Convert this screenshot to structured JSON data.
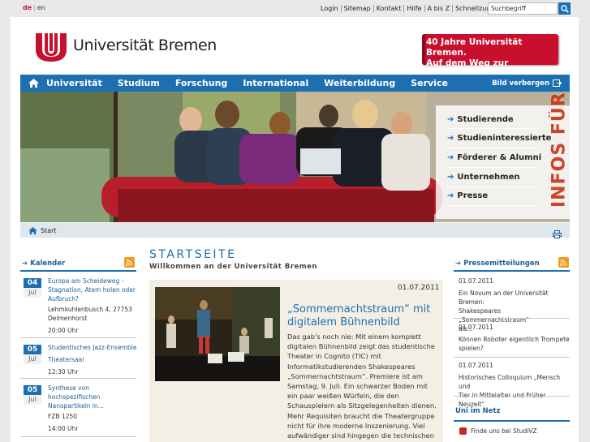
{
  "lang": {
    "de": "de",
    "en": "en"
  },
  "utility": [
    "Login",
    "Sitemap",
    "Kontakt",
    "Hilfe",
    "A bis Z",
    "Schnellzugriff"
  ],
  "search": {
    "placeholder": "Suchbegriff"
  },
  "header": {
    "logo_text": "Universität Bremen",
    "banner_line1": "40 Jahre Universität Bremen.",
    "banner_line2": "Auf dem Weg zur Exzellenz!"
  },
  "nav": {
    "items": [
      "Universität",
      "Studium",
      "Forschung",
      "International",
      "Weiterbildung",
      "Service"
    ],
    "hide_image": "Bild verbergen"
  },
  "hero_menu": {
    "items": [
      "Studierende",
      "Studieninteressierte",
      "Förderer & Alumni",
      "Unternehmen",
      "Presse"
    ],
    "side_text": "INFOS FÜR"
  },
  "breadcrumb": {
    "home": "Start"
  },
  "calendar": {
    "title": "Kalender",
    "events": [
      {
        "day": "04",
        "month": "Jul",
        "title": "Europa am Scheideweg - Stagnation, Atem holen oder Aufbruch?",
        "place": "Lehmkuhlenbusch 4, 27753 Delmenhorst",
        "time": "20:00 Uhr"
      },
      {
        "day": "05",
        "month": "Jul",
        "title": "Studentisches Jazz-Ensemble",
        "place": "Theatersaal",
        "time": "12:30 Uhr"
      },
      {
        "day": "05",
        "month": "Jul",
        "title": "Synthese von hochspezifischen Nanopartikeln in...",
        "place": "FZB 1250",
        "time": "14:00 Uhr"
      }
    ]
  },
  "main": {
    "title": "STARTSEITE",
    "subtitle": "Willkommen an der Universität Bremen",
    "article": {
      "date": "01.07.2011",
      "title": "„Sommernachtstraum“ mit digitalem Bühnenbild",
      "lines": [
        "Das gab's noch nie: Mit einem komplett",
        "digitalen Bühnenbild zeigt das studentische",
        "Theater in Cognito (TIC) mit",
        "Informatikstudierenden Shakespeares",
        "„Sommernachtstraum“. Premiere ist am",
        "Samstag, 9. Juli. Ein schwarzer Boden mit",
        "ein paar weißen Würfeln, die den",
        "Schauspielern als Sitzgelegenheiten dienen.",
        "Mehr Requisiten braucht die Theatergruppe",
        "nicht für ihre moderne Inszenierung. Viel",
        "aufwändiger sind hingegen die technischen"
      ]
    }
  },
  "press": {
    "title": "Pressemitteilungen",
    "items": [
      {
        "date": "01.07.2011",
        "l1": "Ein Novum an der Universität Bremen:",
        "l2": "Shakespeares „Sommernachtstraum“",
        "l3": "als..."
      },
      {
        "date": "01.07.2011",
        "l1": "Können Roboter eigentlich Trompete",
        "l2": "spielen?",
        "l3": ""
      },
      {
        "date": "01.07.2011",
        "l1": "Historisches Colloquium „Mensch und",
        "l2": "Tier in Mittelalter und Früher Neuzeit“",
        "l3": ""
      }
    ]
  },
  "uni_net": {
    "title": "Uni im Netz",
    "items": [
      "Finde uns bei StudiVZ"
    ]
  },
  "colors": {
    "brand_red": "#c8102e",
    "brand_blue": "#1c6fb0"
  }
}
